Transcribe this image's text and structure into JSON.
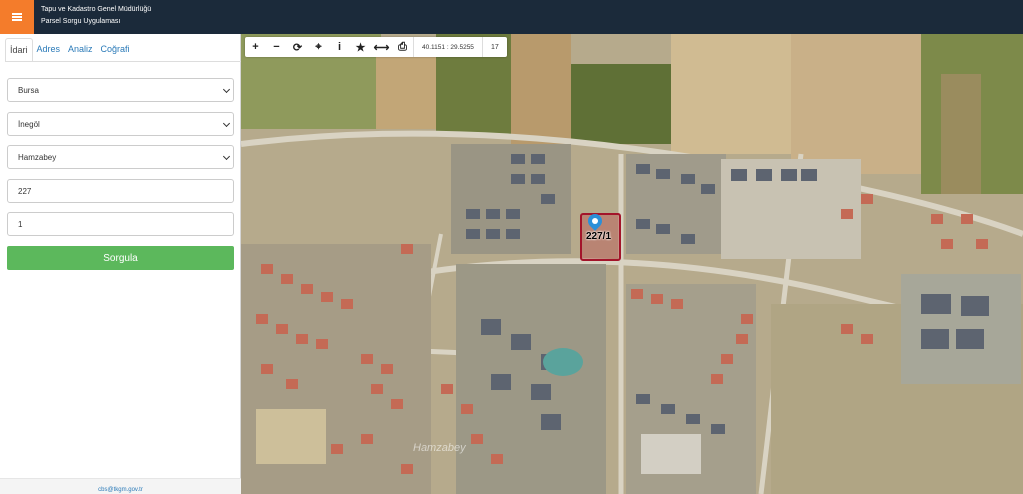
{
  "header": {
    "title_line1": "Tapu ve Kadastro Genel Müdürlüğü",
    "title_line2": "Parsel Sorgu Uygulaması",
    "menu_icon": "hamburger-icon",
    "accent_color": "#f47c2b",
    "bar_color": "#1b2a3a"
  },
  "sidebar": {
    "tabs": [
      {
        "label": "İdari",
        "active": true
      },
      {
        "label": "Adres",
        "active": false
      },
      {
        "label": "Analiz",
        "active": false
      },
      {
        "label": "Coğrafi",
        "active": false
      }
    ],
    "fields": {
      "province": "Bursa",
      "district": "İnegöl",
      "neighborhood": "Hamzabey",
      "block": "227",
      "parcel": "1"
    },
    "submit_label": "Sorgula",
    "submit_color": "#5cb85c",
    "footer_email": "cbs@tkgm.gov.tr"
  },
  "map": {
    "toolbar": {
      "tools": [
        {
          "icon": "zoom-in-icon",
          "glyph": "+"
        },
        {
          "icon": "zoom-out-icon",
          "glyph": "−"
        },
        {
          "icon": "refresh-icon",
          "glyph": "⟳"
        },
        {
          "icon": "locate-icon",
          "glyph": "⌖"
        },
        {
          "icon": "info-icon",
          "glyph": "i"
        },
        {
          "icon": "star-icon",
          "glyph": "★"
        },
        {
          "icon": "measure-icon",
          "glyph": "⟷"
        },
        {
          "icon": "print-icon",
          "glyph": "⎙"
        }
      ],
      "coordinates": "40.1151 : 29.5255",
      "zoom_level": "17"
    },
    "parcel_label": "227/1",
    "parcel_color": "#a3142a",
    "pin_color": "#2b8fd8",
    "watermark": "Hamzabey"
  }
}
